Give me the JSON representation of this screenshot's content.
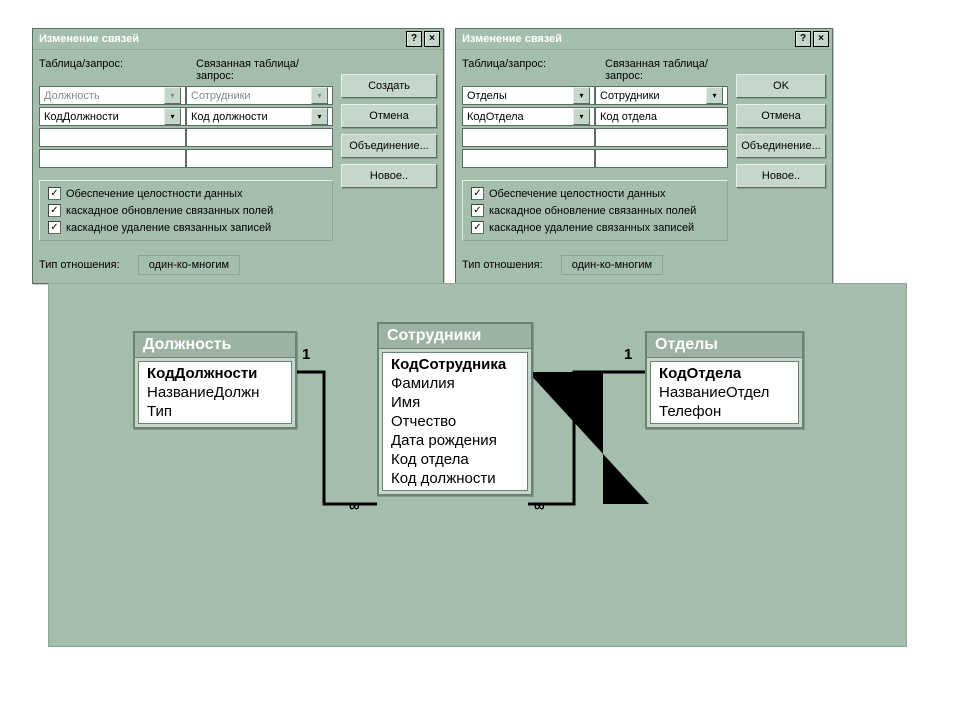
{
  "dialog1": {
    "title": "Изменение связей",
    "tableHeader": "Таблица/запрос:",
    "relatedHeader": "Связанная таблица/запрос:",
    "table": "Должность",
    "related": "Сотрудники",
    "field1": "КодДолжности",
    "field2": "Код должности",
    "opt1": "Обеспечение целостности данных",
    "opt2": "каскадное обновление связанных полей",
    "opt3": "каскадное удаление связанных записей",
    "typeLabel": "Тип отношения:",
    "typeValue": "один-ко-многим",
    "buttons": {
      "b1": "Создать",
      "b2": "Отмена",
      "b3": "Объединение...",
      "b4": "Новое.."
    }
  },
  "dialog2": {
    "title": "Изменение связей",
    "tableHeader": "Таблица/запрос:",
    "relatedHeader": "Связанная таблица/запрос:",
    "table": "Отделы",
    "related": "Сотрудники",
    "field1": "КодОтдела",
    "field2": "Код отдела",
    "opt1": "Обеспечение целостности данных",
    "opt2": "каскадное обновление связанных полей",
    "opt3": "каскадное удаление связанных записей",
    "typeLabel": "Тип отношения:",
    "typeValue": "один-ко-многим",
    "buttons": {
      "b1": "OK",
      "b2": "Отмена",
      "b3": "Объединение...",
      "b4": "Новое.."
    }
  },
  "tables": {
    "t1": {
      "title": "Должность",
      "fields": [
        "КодДолжности",
        "НазваниеДолжн",
        "Тип"
      ]
    },
    "t2": {
      "title": "Сотрудники",
      "fields": [
        "КодСотрудника",
        "Фамилия",
        "Имя",
        "Отчество",
        "Дата рождения",
        "Код отдела",
        "Код должности"
      ]
    },
    "t3": {
      "title": "Отделы",
      "fields": [
        "КодОтдела",
        "НазваниеОтдел",
        "Телефон"
      ]
    }
  },
  "rel": {
    "one": "1",
    "many": "∞"
  }
}
